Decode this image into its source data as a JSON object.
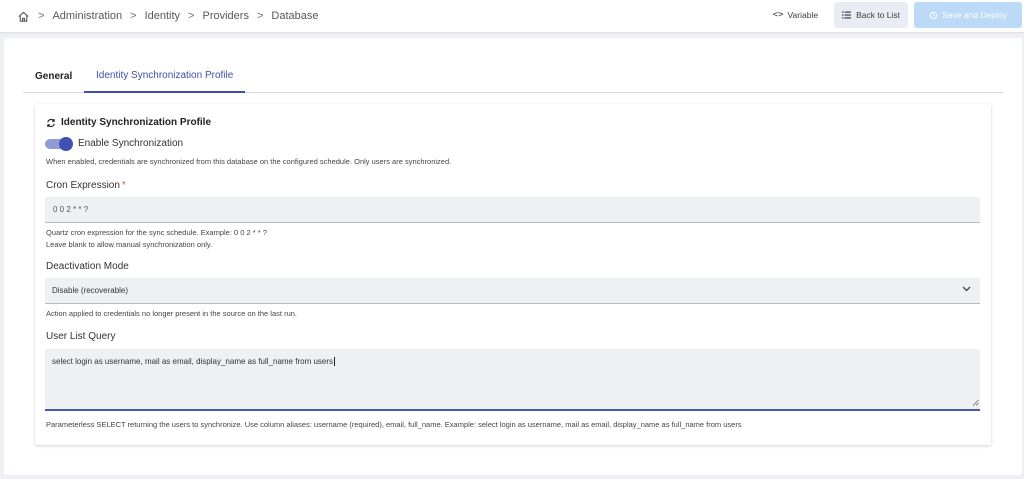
{
  "breadcrumb": {
    "items": [
      "Administration",
      "Identity",
      "Providers",
      "Database"
    ],
    "separator": ">"
  },
  "actions": {
    "variable_label": "Variable",
    "variable_icon": "<>",
    "back_label": "Back to List",
    "save_label": "Save and Deploy"
  },
  "tabs": [
    {
      "label": "General",
      "active": false
    },
    {
      "label": "Identity Synchronization Profile",
      "active": true
    }
  ],
  "card": {
    "title": "Identity Synchronization Profile",
    "toggle_label": "Enable Synchronization",
    "toggle_on": true,
    "toggle_help": "When enabled, credentials are synchronized from this database on the configured schedule. Only users are synchronized.",
    "cron": {
      "label": "Cron Expression",
      "required_mark": "*",
      "value": "0 0 2 * * ?",
      "help_line1": "Quartz cron expression for the sync schedule. Example: 0 0 2 * * ?",
      "help_line2": "Leave blank to allow manual synchronization only."
    },
    "deactivation": {
      "label": "Deactivation Mode",
      "value": "Disable (recoverable)",
      "help": "Action applied to credentials no longer present in the source on the last run."
    },
    "query": {
      "label": "User List Query",
      "value": "select login as username, mail as email, display_name as full_name from users",
      "help": "Parameterless SELECT returning the users to synchronize. Use column aliases: username (required), email, full_name. Example: select login as username, mail as email, display_name as full_name from users"
    }
  },
  "colors": {
    "accent": "#3f51b5",
    "tab_active": "#3d4fa8",
    "save_disabled": "#bcd9f8",
    "required": "#e05a47"
  }
}
